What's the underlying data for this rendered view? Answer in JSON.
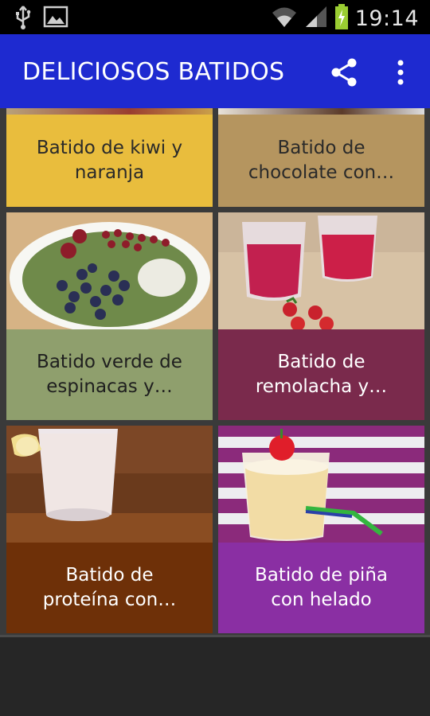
{
  "status_bar": {
    "time": "19:14",
    "icons": [
      "usb-icon",
      "image-icon",
      "wifi-icon",
      "signal-icon",
      "battery-charging-icon"
    ]
  },
  "app_bar": {
    "title": "DELICIOSOS BATIDOS",
    "actions": [
      "share-icon",
      "more-vert-icon"
    ]
  },
  "recipes": [
    {
      "title": "Batido de kiwi y naranja",
      "caption_lines": [
        "Batido de kiwi y",
        "naranja"
      ],
      "caption_color": "#e9bd3d",
      "text_color": "#2a2a2a"
    },
    {
      "title": "Batido de chocolate con…",
      "caption_lines": [
        "Batido de",
        "chocolate con…"
      ],
      "caption_color": "#b5955f",
      "text_color": "#2a2a2a"
    },
    {
      "title": "Batido verde de espinacas y…",
      "caption_lines": [
        "Batido verde de",
        "espinacas y…"
      ],
      "caption_color": "#8f9f6d",
      "text_color": "#1f1f1f"
    },
    {
      "title": "Batido de remolacha y…",
      "caption_lines": [
        "Batido de",
        "remolacha y…"
      ],
      "caption_color": "#7a2a4c",
      "text_color": "#ffffff"
    },
    {
      "title": "Batido de proteína con…",
      "caption_lines": [
        "Batido de",
        "proteína con…"
      ],
      "caption_color": "#6e3008",
      "text_color": "#ffffff"
    },
    {
      "title": "Batido de piña con helado",
      "caption_lines": [
        "Batido de piña",
        "con helado"
      ],
      "caption_color": "#8a2fa3",
      "text_color": "#ffffff"
    }
  ]
}
